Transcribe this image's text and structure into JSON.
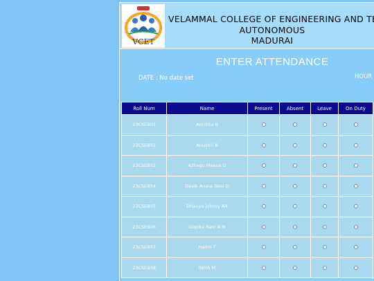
{
  "header": {
    "college_name": "VELAMMAL COLLEGE OF ENGINEERING AND TECHNOLOGY",
    "status": "AUTONOMOUS",
    "city": "MADURAI",
    "logo_text": "VCET"
  },
  "title": "ENTER ATTENDANCE",
  "date_text": "DATE : No date set",
  "hour_text": "HOUR",
  "table": {
    "columns": [
      "Roll Num",
      "Name",
      "Present",
      "Absent",
      "Leave",
      "On Duty"
    ],
    "rows": [
      {
        "roll": "23CSEB01",
        "name": "Amritha B"
      },
      {
        "roll": "23CSEB02",
        "name": "Anushri B"
      },
      {
        "roll": "23CSEB03",
        "name": "Azhagu Meena G"
      },
      {
        "roll": "23CSEB04",
        "name": "Devik Aruna Devi D"
      },
      {
        "roll": "23CSEB05",
        "name": "Dhanya johnsy AR"
      },
      {
        "roll": "23CSEB06",
        "name": "Gopika Rani A M"
      },
      {
        "roll": "23CSEB07",
        "name": "Harini T"
      },
      {
        "roll": "23CSEB08",
        "name": "INIYA M"
      }
    ]
  }
}
